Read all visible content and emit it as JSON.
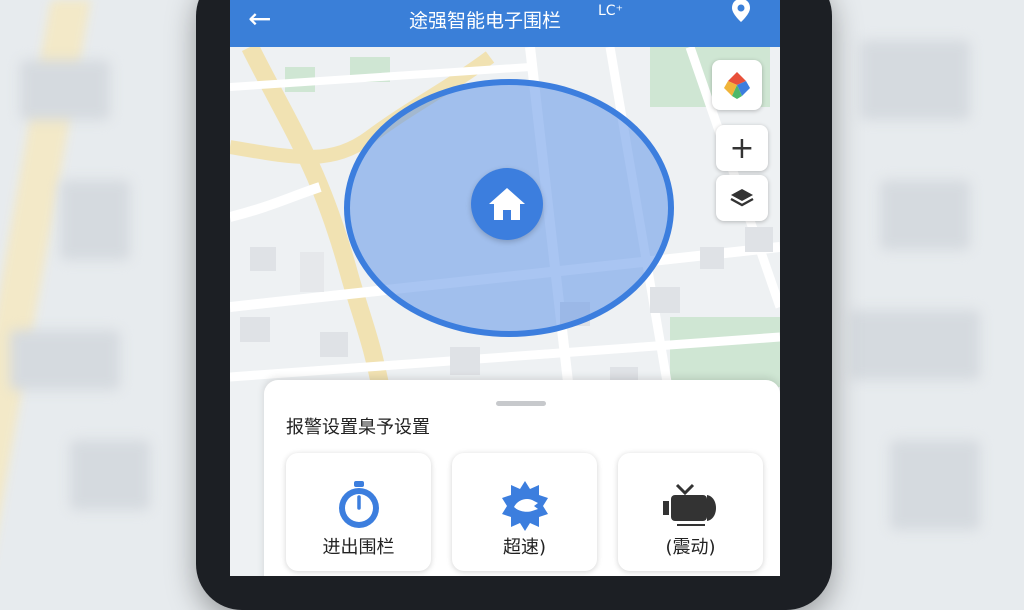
{
  "header": {
    "back_icon": "arrow-left-icon",
    "title": "途强智能电子围栏",
    "lc_label": "LC⁺",
    "pin_icon": "location-pin-icon"
  },
  "map": {
    "home_icon": "home-icon",
    "controls": {
      "compass_icon": "app-logo-icon",
      "zoom_in_label": "+",
      "layers_icon": "layers-icon"
    }
  },
  "panel": {
    "title": "报警设置臬予设置",
    "options": [
      {
        "label": "进出围栏",
        "icon": "stopwatch-icon"
      },
      {
        "label": "超速)",
        "icon": "speed-badge-icon"
      },
      {
        "label": "(震动)",
        "icon": "vibration-icon"
      }
    ]
  },
  "colors": {
    "header": "#3a7fd8",
    "accent": "#3c7ede",
    "geofence_fill": "rgba(98,150,232,0.55)"
  }
}
